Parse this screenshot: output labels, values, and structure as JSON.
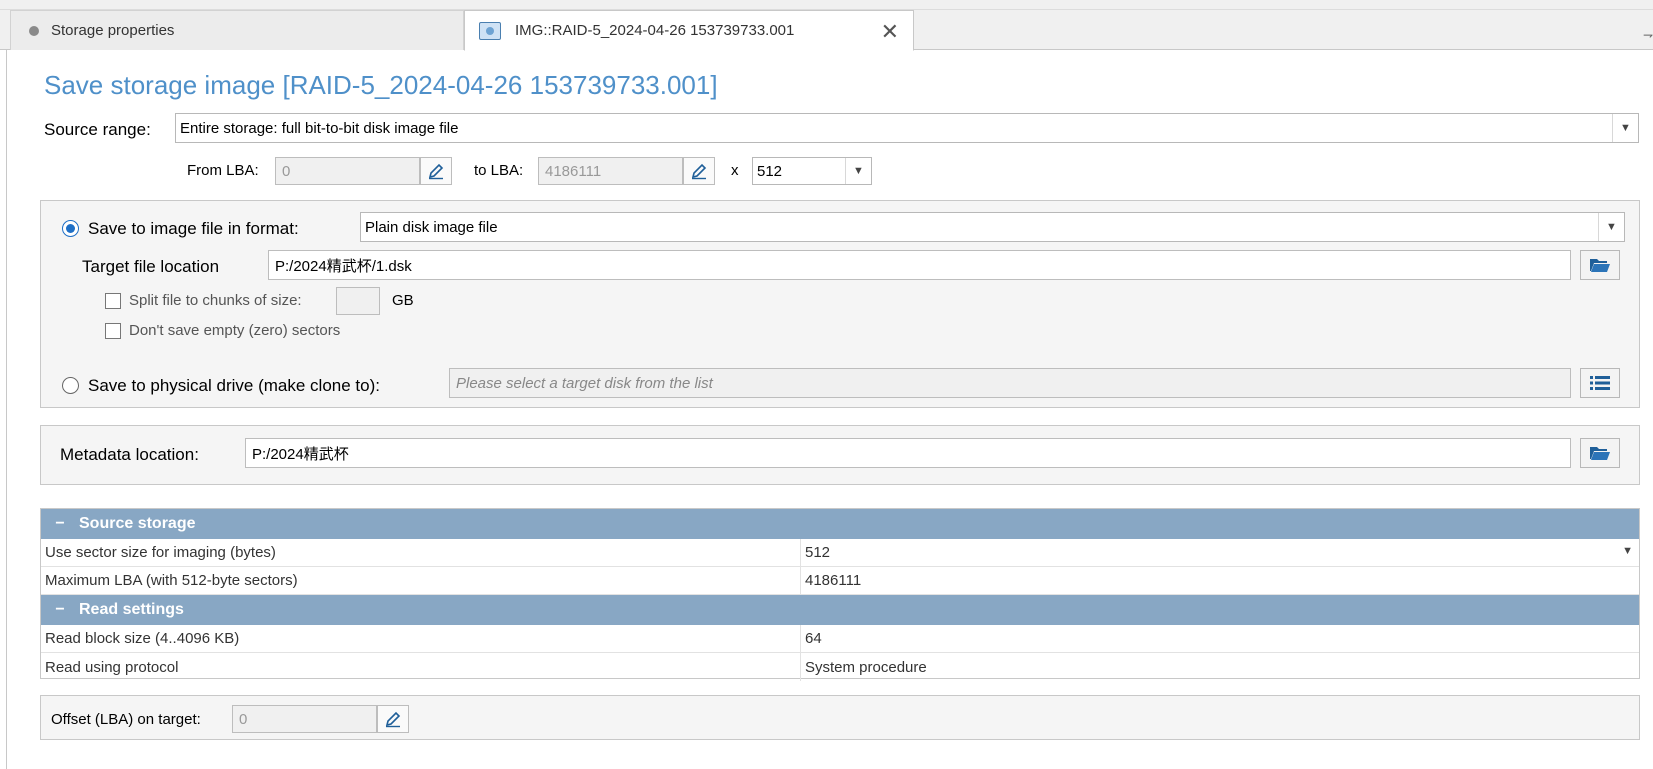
{
  "tabs": [
    {
      "label": "Storage properties",
      "active": false
    },
    {
      "label": "IMG::RAID-5_2024-04-26 153739733.001",
      "active": true
    }
  ],
  "page_title": "Save storage image [RAID-5_2024-04-26 153739733.001]",
  "source_range": {
    "label": "Source range:",
    "value": "Entire storage: full bit-to-bit disk image file",
    "from_lba_label": "From LBA:",
    "from_lba_value": "0",
    "to_lba_label": "to LBA:",
    "to_lba_value": "4186111",
    "times_label": "x",
    "sector_size": "512"
  },
  "save_image": {
    "radio_label": "Save to image file in format:",
    "format_value": "Plain disk image file",
    "target_label": "Target file location",
    "target_value": "P:/2024精武杯/1.dsk",
    "split_label": "Split file to chunks of size:",
    "split_value": "",
    "split_unit": "GB",
    "skip_empty_label": "Don't save empty (zero) sectors"
  },
  "save_physical": {
    "radio_label": "Save to physical drive (make clone to):",
    "placeholder": "Please select a target disk from the list"
  },
  "metadata": {
    "label": "Metadata location:",
    "value": "P:/2024精武杯"
  },
  "grid": {
    "source_storage": {
      "header": "Source storage",
      "rows": [
        {
          "name": "Use sector size for imaging (bytes)",
          "value": "512"
        },
        {
          "name": "Maximum LBA (with 512-byte sectors)",
          "value": "4186111"
        }
      ]
    },
    "read_settings": {
      "header": "Read settings",
      "rows": [
        {
          "name": "Read block size (4..4096 KB)",
          "value": "64"
        },
        {
          "name": "Read using protocol",
          "value": "System procedure"
        }
      ]
    }
  },
  "offset": {
    "label": "Offset (LBA) on target:",
    "value": "0"
  },
  "colors": {
    "title": "#4f90c9",
    "grid_header": "#88a7c4",
    "radio_accent": "#1e6fc6"
  }
}
